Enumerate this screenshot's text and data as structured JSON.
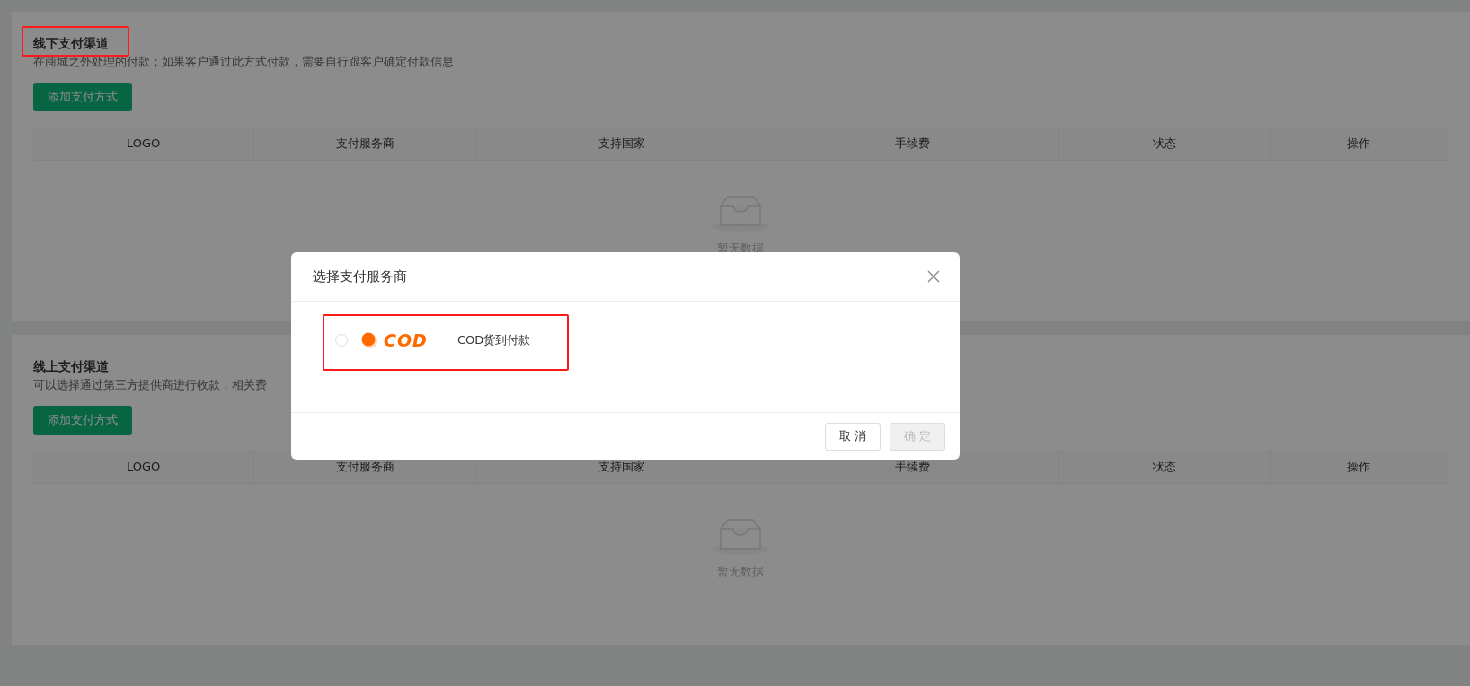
{
  "sections": [
    {
      "title": "线下支付渠道",
      "highlighted": true,
      "description": "在商城之外处理的付款；如果客户通过此方式付款，需要自行跟客户确定付款信息",
      "add_button": "添加支付方式",
      "table": {
        "columns": [
          "LOGO",
          "支付服务商",
          "支持国家",
          "手续费",
          "状态",
          "操作"
        ],
        "empty_text": "暂无数据"
      }
    },
    {
      "title": "线上支付渠道",
      "highlighted": false,
      "description": "可以选择通过第三方提供商进行收款，相关费",
      "add_button": "添加支付方式",
      "table": {
        "columns": [
          "LOGO",
          "支付服务商",
          "支持国家",
          "手续费",
          "状态",
          "操作"
        ],
        "empty_text": "暂无数据"
      }
    }
  ],
  "dialog": {
    "title": "选择支付服务商",
    "options": [
      {
        "selected": false,
        "highlighted": true,
        "logo_text": "COD",
        "name": "COD货到付款"
      }
    ],
    "buttons": [
      {
        "label": "取 消",
        "kind": "cancel",
        "disabled": false
      },
      {
        "label": "确 定",
        "kind": "confirm",
        "disabled": true
      }
    ]
  }
}
